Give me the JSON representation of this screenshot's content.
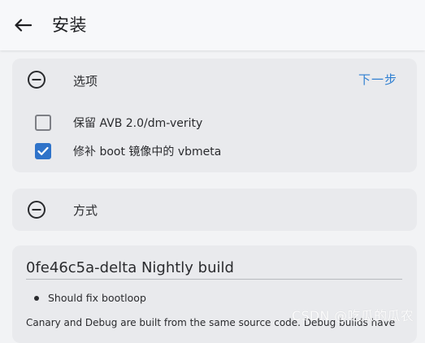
{
  "appbar": {
    "back_icon": "arrow-left-icon",
    "title": "安装"
  },
  "options_section": {
    "icon": "minus-circle-icon",
    "title": "选项",
    "next_label": "下一步",
    "items": [
      {
        "label": "保留 AVB 2.0/dm-verity",
        "checked": false
      },
      {
        "label": "修补 boot 镜像中的 vbmeta",
        "checked": true
      }
    ]
  },
  "method_section": {
    "icon": "minus-circle-icon",
    "title": "方式"
  },
  "notes": {
    "title": "0fe46c5a-delta Nightly build",
    "bullets": [
      "Should fix bootloop"
    ],
    "paragraph": "Canary and Debug are built from the same source code.  Debug builds have"
  },
  "watermark": "CSDN @吃瓜的瓜农",
  "colors": {
    "accent": "#2f7fd1",
    "checkbox_checked": "#2f73c9",
    "card_bg": "#e9eaed",
    "page_bg": "#f2f3f5"
  }
}
